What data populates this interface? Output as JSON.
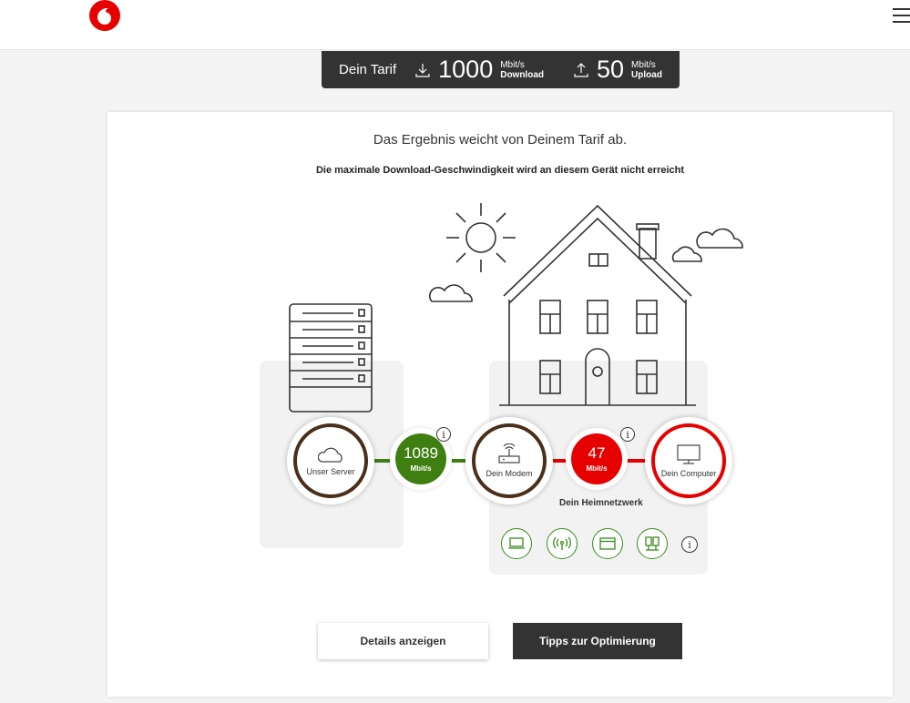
{
  "tarif": {
    "label": "Dein Tarif",
    "download_value": "1000",
    "download_unit": "Mbit/s",
    "download_label": "Download",
    "upload_value": "50",
    "upload_unit": "Mbit/s",
    "upload_label": "Upload"
  },
  "result": {
    "headline": "Das Ergebnis weicht von Deinem Tarif ab.",
    "subline": "Die maximale Download-Geschwindigkeit wird an diesem Gerät nicht erreicht"
  },
  "nodes": {
    "server": "Unser Server",
    "modem": "Dein Modem",
    "computer": "Dein Computer"
  },
  "speeds": {
    "server_modem": {
      "value": "1089",
      "unit": "Mbit/s",
      "color": "#3f7f12"
    },
    "modem_computer": {
      "value": "47",
      "unit": "Mbit/s",
      "color": "#e60000"
    }
  },
  "heimnetzwerk_label": "Dein Heimnetzwerk",
  "colors": {
    "brand": "#e60000",
    "good": "#3f7f12",
    "dark": "#333333"
  },
  "buttons": {
    "details": "Details anzeigen",
    "tipps": "Tipps zur Optimierung"
  }
}
